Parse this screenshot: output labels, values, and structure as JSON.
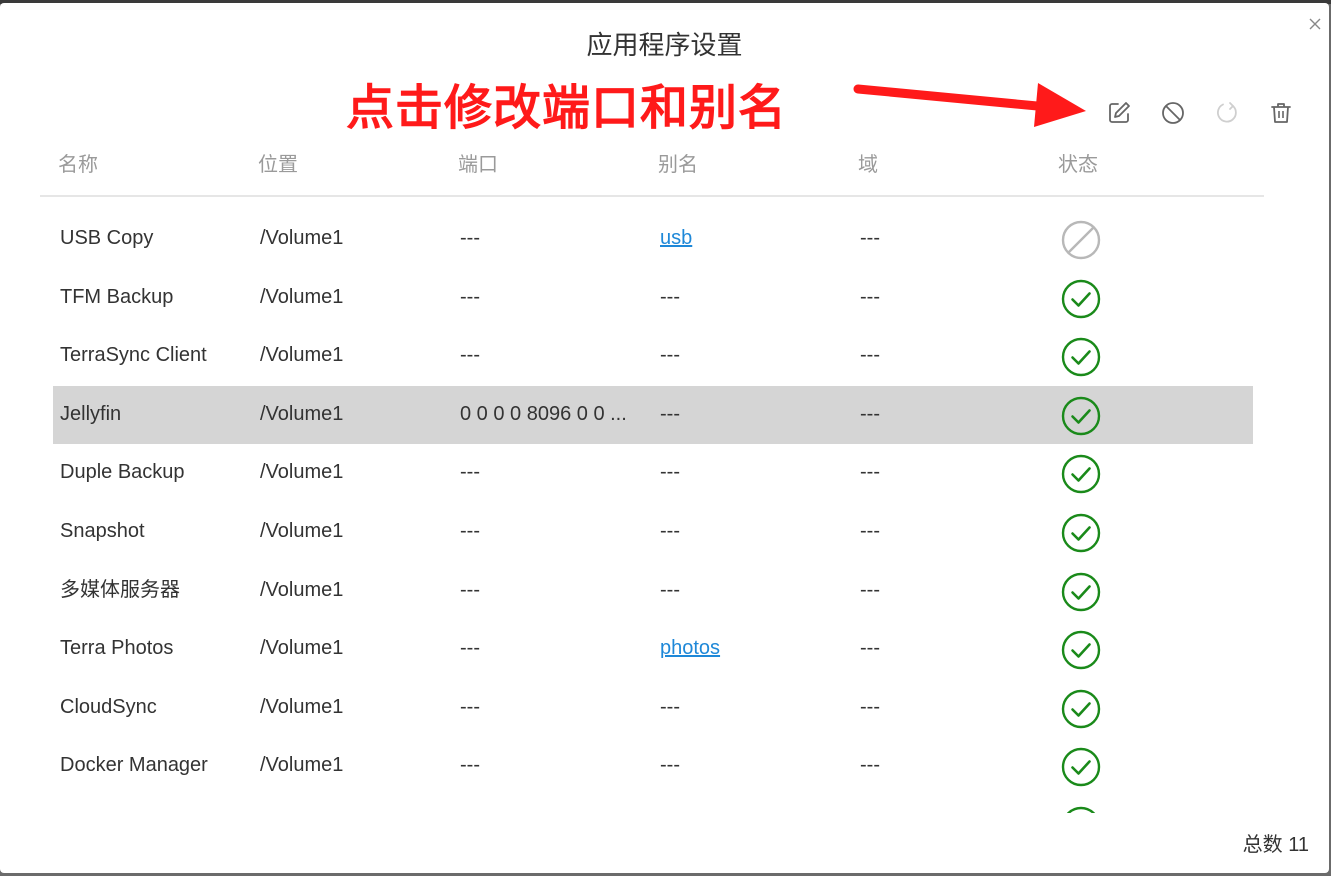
{
  "dialog": {
    "title": "应用程序设置",
    "annotation": "点击修改端口和别名",
    "total_label": "总数 11"
  },
  "toolbar": {
    "buttons": [
      {
        "name": "edit-button",
        "icon": "edit-icon",
        "enabled": true
      },
      {
        "name": "disable-button",
        "icon": "disable-icon",
        "enabled": true
      },
      {
        "name": "refresh-button",
        "icon": "refresh-icon",
        "enabled": false
      },
      {
        "name": "delete-button",
        "icon": "trash-icon",
        "enabled": true
      }
    ]
  },
  "table": {
    "columns": [
      "名称",
      "位置",
      "端口",
      "别名",
      "域",
      "状态"
    ],
    "rows": [
      {
        "name": "USB Copy",
        "location": "/Volume1",
        "port": "---",
        "alias": "usb",
        "alias_link": true,
        "domain": "---",
        "status": "disabled",
        "selected": false
      },
      {
        "name": "TFM Backup",
        "location": "/Volume1",
        "port": "---",
        "alias": "---",
        "alias_link": false,
        "domain": "---",
        "status": "enabled",
        "selected": false
      },
      {
        "name": "TerraSync Client",
        "location": "/Volume1",
        "port": "---",
        "alias": "---",
        "alias_link": false,
        "domain": "---",
        "status": "enabled",
        "selected": false
      },
      {
        "name": "Jellyfin",
        "location": "/Volume1",
        "port": "0 0 0 0 8096 0 0 ...",
        "alias": "---",
        "alias_link": false,
        "domain": "---",
        "status": "enabled",
        "selected": true
      },
      {
        "name": "Duple Backup",
        "location": "/Volume1",
        "port": "---",
        "alias": "---",
        "alias_link": false,
        "domain": "---",
        "status": "enabled",
        "selected": false
      },
      {
        "name": "Snapshot",
        "location": "/Volume1",
        "port": "---",
        "alias": "---",
        "alias_link": false,
        "domain": "---",
        "status": "enabled",
        "selected": false
      },
      {
        "name": "多媒体服务器",
        "location": "/Volume1",
        "port": "---",
        "alias": "---",
        "alias_link": false,
        "domain": "---",
        "status": "enabled",
        "selected": false
      },
      {
        "name": "Terra Photos",
        "location": "/Volume1",
        "port": "---",
        "alias": "photos",
        "alias_link": true,
        "domain": "---",
        "status": "enabled",
        "selected": false
      },
      {
        "name": "CloudSync",
        "location": "/Volume1",
        "port": "---",
        "alias": "---",
        "alias_link": false,
        "domain": "---",
        "status": "enabled",
        "selected": false
      },
      {
        "name": "Docker Manager",
        "location": "/Volume1",
        "port": "---",
        "alias": "---",
        "alias_link": false,
        "domain": "---",
        "status": "enabled",
        "selected": false
      },
      {
        "name": "",
        "location": "",
        "port": "",
        "alias": "",
        "alias_link": false,
        "domain": "",
        "status": "enabled",
        "selected": false
      }
    ]
  },
  "colors": {
    "enabled": "#1a8a1a",
    "disabled": "#b8b8b8",
    "link": "#1e88d8",
    "annotation": "#ff1a1a",
    "selected_row": "#d5d5d5"
  }
}
